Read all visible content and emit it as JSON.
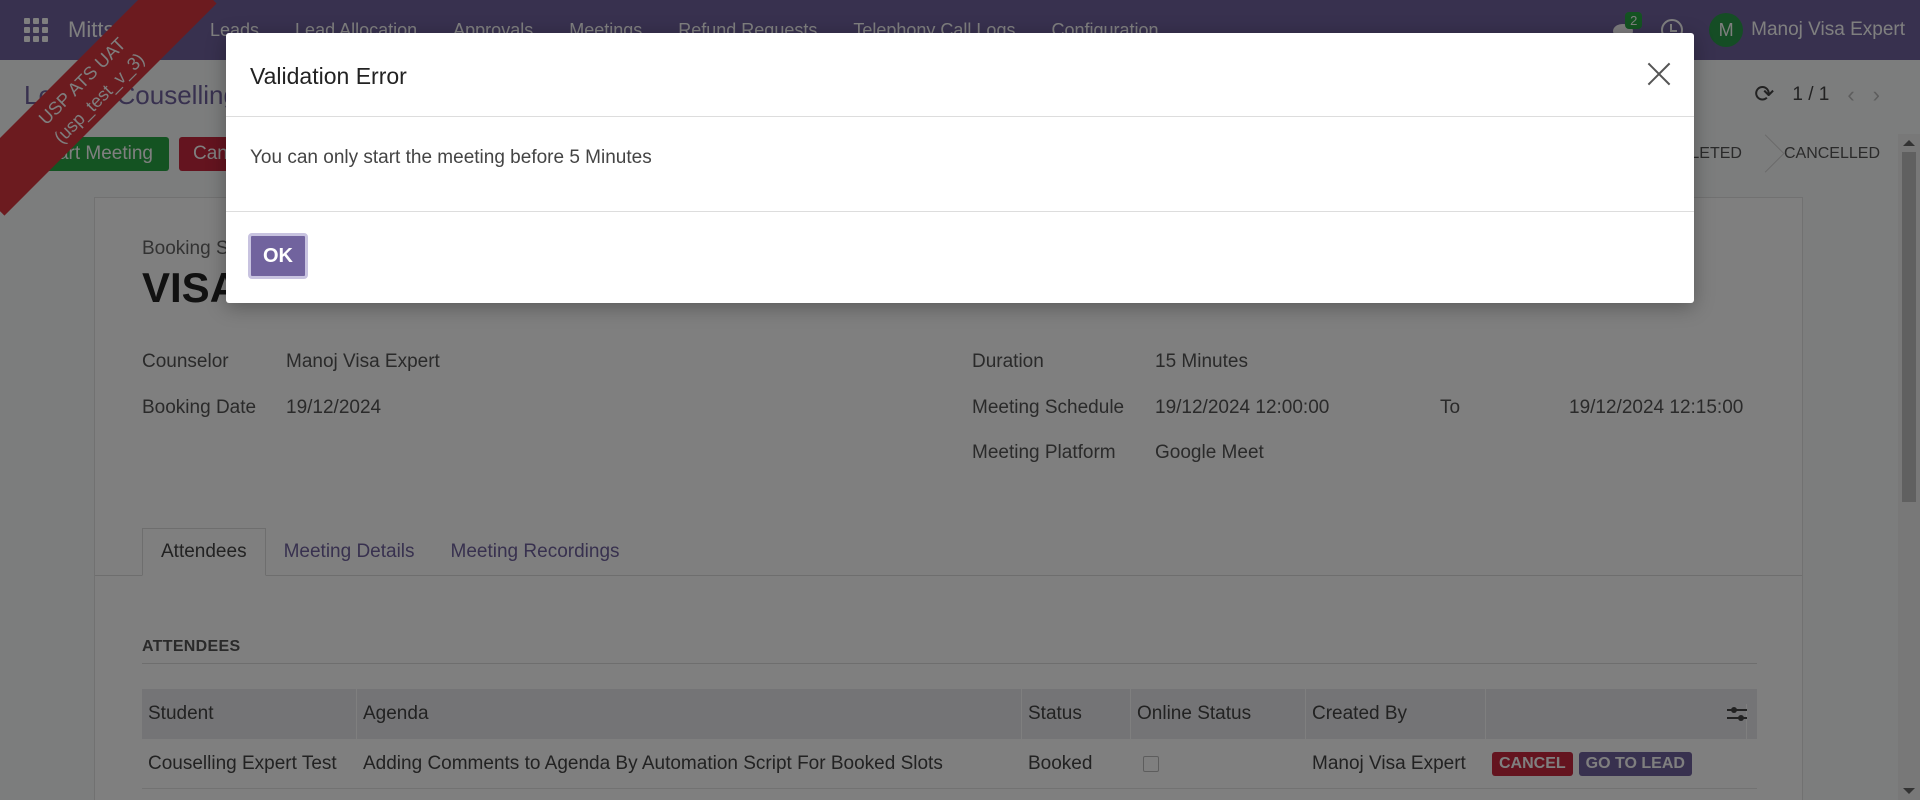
{
  "navbar": {
    "brand": "Mitts ATS",
    "menu": [
      "Leads",
      "Lead Allocation",
      "Approvals",
      "Meetings",
      "Refund Requests",
      "Telephony Call Logs",
      "Configuration"
    ],
    "chat_count": "2",
    "user_initial": "M",
    "user_name": "Manoj Visa Expert"
  },
  "ribbon": {
    "line1": "USP ATS UAT",
    "line2": "(usp_test_v_3)"
  },
  "control_panel": {
    "breadcrumb": "Leads / Couselling",
    "pager": "1 / 1",
    "start_meeting_label": "Start Meeting",
    "cancel_label": "Cancel",
    "statuses": [
      "COMPLETED",
      "CANCELLED"
    ]
  },
  "form": {
    "subtitle": "Booking Slot",
    "title": "VISA",
    "fields": {
      "counselor_label": "Counselor",
      "counselor_value": "Manoj Visa Expert",
      "booking_date_label": "Booking Date",
      "booking_date_value": "19/12/2024",
      "duration_label": "Duration",
      "duration_value": "15 Minutes",
      "schedule_label": "Meeting Schedule",
      "schedule_from": "19/12/2024 12:00:00",
      "schedule_to_label": "To",
      "schedule_to": "19/12/2024 12:15:00",
      "platform_label": "Meeting Platform",
      "platform_value": "Google Meet"
    },
    "tabs": [
      "Attendees",
      "Meeting Details",
      "Meeting Recordings"
    ],
    "section_title": "ATTENDEES",
    "table": {
      "headers": [
        "Student",
        "Agenda",
        "Status",
        "Online Status",
        "Created By"
      ],
      "rows": [
        {
          "student": "Couselling Expert Test",
          "agenda": "Adding Comments to Agenda By Automation Script For Booked Slots",
          "status": "Booked",
          "created_by": "Manoj Visa Expert",
          "cancel_label": "CANCEL",
          "go_to_lead_label": "GO TO LEAD"
        }
      ]
    }
  },
  "modal": {
    "title": "Validation Error",
    "message": "You can only start the meeting before 5 Minutes",
    "ok_label": "OK"
  }
}
